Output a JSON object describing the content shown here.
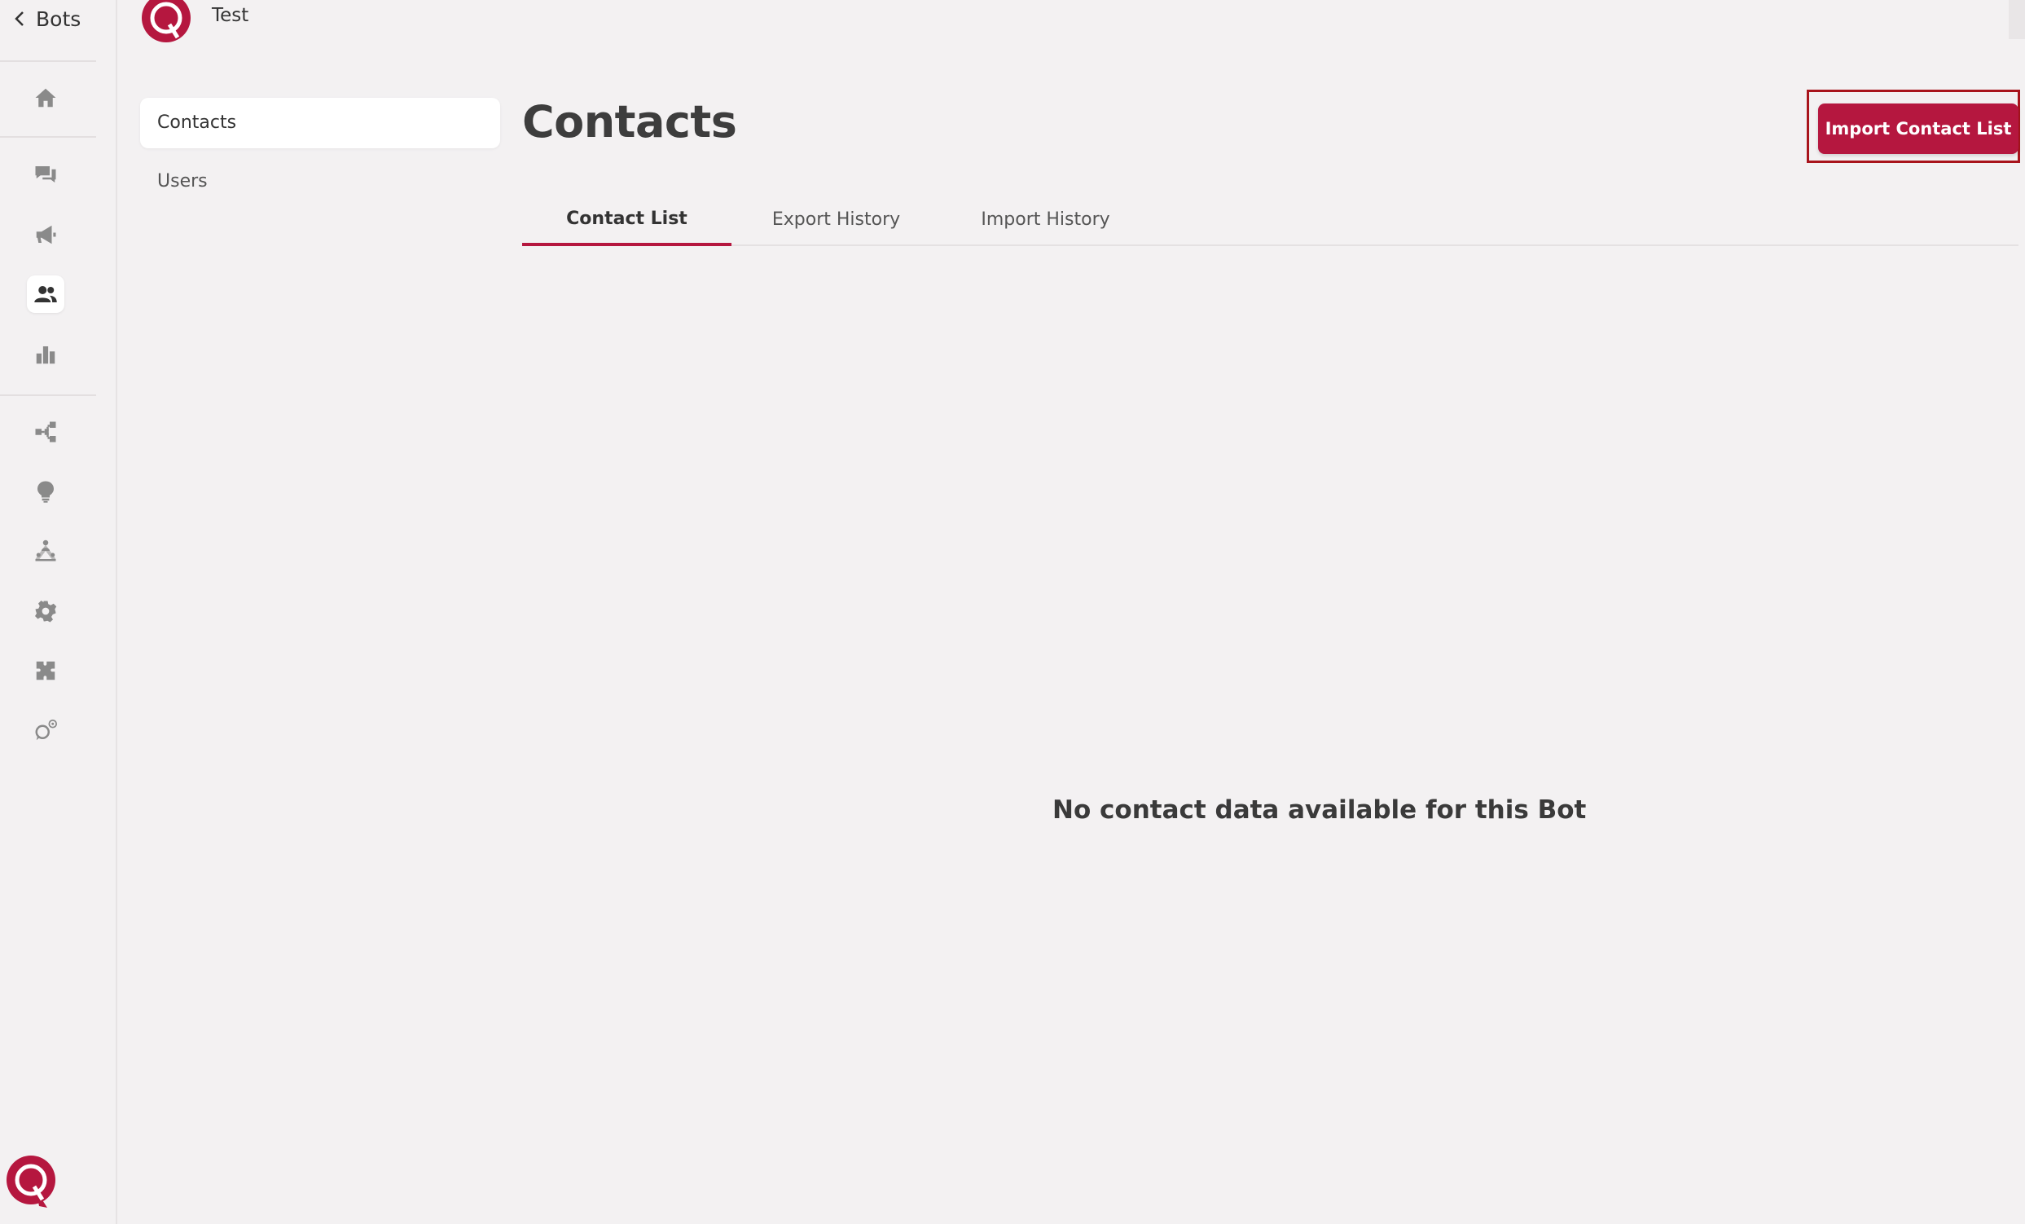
{
  "rail": {
    "back_label": "Bots",
    "icons": [
      "home-icon",
      "chat-icon",
      "megaphone-icon",
      "users-icon",
      "bar-chart-icon",
      "flow-icon",
      "lightbulb-icon",
      "hierarchy-icon",
      "gear-icon",
      "puzzle-icon",
      "whatsapp-settings-icon"
    ],
    "active_icon": "users-icon"
  },
  "header": {
    "bot_name": "Test"
  },
  "subnav": {
    "items": [
      {
        "label": "Contacts",
        "active": true
      },
      {
        "label": "Users",
        "active": false
      }
    ]
  },
  "main": {
    "title": "Contacts",
    "import_button": "Import Contact List",
    "tabs": [
      {
        "label": "Contact List",
        "active": true
      },
      {
        "label": "Export History",
        "active": false
      },
      {
        "label": "Import History",
        "active": false
      }
    ],
    "empty_message": "No contact data available for this Bot"
  },
  "colors": {
    "accent": "#b5173f",
    "background": "#f3f1f2",
    "focus_outline": "#a8141c"
  }
}
